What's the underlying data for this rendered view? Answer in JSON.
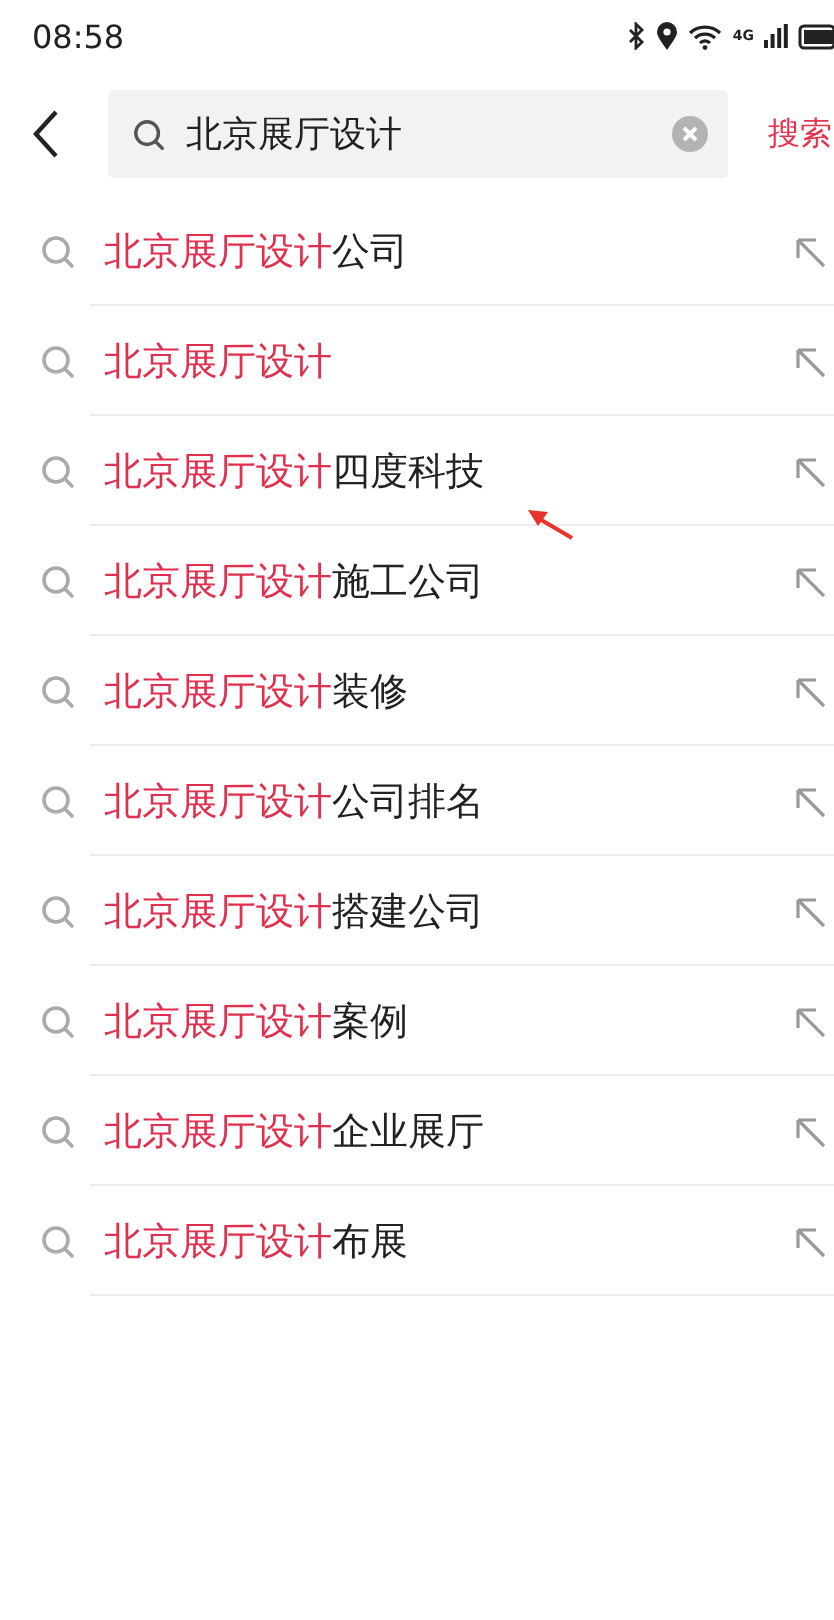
{
  "status_bar": {
    "time": "08:58",
    "network": "4G"
  },
  "search": {
    "value": "北京展厅设计",
    "action": "搜索"
  },
  "suggestions": [
    {
      "match": "北京展厅设计",
      "rest": "公司"
    },
    {
      "match": "北京展厅设计"
    },
    {
      "match": "北京展厅设计",
      "rest": "四度科技",
      "annotated": true
    },
    {
      "match": "北京展厅设计",
      "rest": "施工公司"
    },
    {
      "match": "北京展厅设计",
      "rest": "装修"
    },
    {
      "match": "北京展厅设计",
      "rest": "公司排名"
    },
    {
      "match": "北京展厅设计",
      "rest": "搭建公司"
    },
    {
      "match": "北京展厅设计",
      "rest": "案例"
    },
    {
      "match": "北京展厅设计",
      "rest": "企业展厅"
    },
    {
      "match": "北京展厅设计",
      "rest": "布展"
    }
  ]
}
